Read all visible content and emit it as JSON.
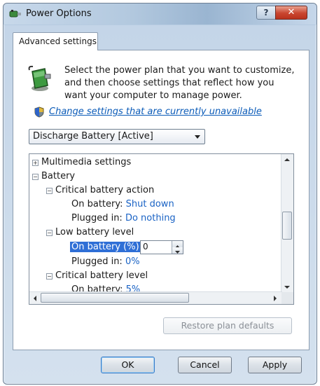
{
  "window": {
    "title": "Power Options",
    "help_label": "?",
    "close_label": "✕"
  },
  "tab": {
    "label": "Advanced settings"
  },
  "description": "Select the power plan that you want to customize, and then choose settings that reflect how you want your computer to manage power.",
  "change_link": "Change settings that are currently unavailable",
  "plan_select": {
    "value": "Discharge Battery [Active]"
  },
  "tree": {
    "multimedia": "Multimedia settings",
    "battery": "Battery",
    "critical_action": "Critical battery action",
    "critical_action_on_battery_label": "On battery:",
    "critical_action_on_battery_value": "Shut down",
    "critical_action_plugged_label": "Plugged in:",
    "critical_action_plugged_value": "Do nothing",
    "low_level": "Low battery level",
    "low_level_on_battery_label": "On battery (%):",
    "low_level_on_battery_value": "0",
    "low_level_plugged_label": "Plugged in:",
    "low_level_plugged_value": "0%",
    "critical_level": "Critical battery level",
    "critical_level_on_battery_label": "On battery:",
    "critical_level_on_battery_value": "5%"
  },
  "buttons": {
    "restore_label": "Restore plan defaults",
    "ok_label": "OK",
    "cancel_label": "Cancel",
    "apply_label": "Apply"
  },
  "colors": {
    "link": "#0b5bb8",
    "value": "#1a63c5",
    "selection": "#2f6fd6",
    "close": "#c9452f"
  },
  "icons": {
    "app": "power-plug-icon",
    "power": "battery-plug-icon",
    "shield": "uac-shield-icon"
  }
}
